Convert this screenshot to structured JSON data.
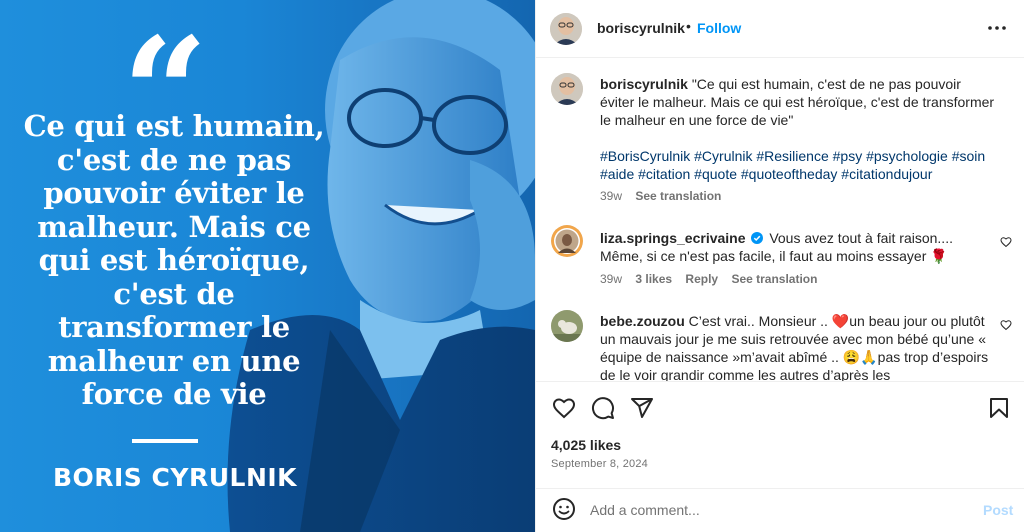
{
  "post_image": {
    "quote_mark": "“",
    "quote_lines": [
      "Ce qui est humain,",
      "c'est de ne pas",
      "pouvoir éviter le",
      "malheur. Mais ce",
      "qui est héroïque,",
      "c'est de",
      "transformer le",
      "malheur en une",
      "force de vie"
    ],
    "author": "BORIS CYRULNIK"
  },
  "header": {
    "username": "boriscyrulnik",
    "separator": "•",
    "follow_label": "Follow",
    "more_icon": "more-horizontal-icon"
  },
  "caption": {
    "username": "boriscyrulnik",
    "text": "\"Ce qui est humain, c'est de ne pas pouvoir éviter le malheur. Mais ce qui est héroïque, c'est de transformer le malheur en une force de vie\"",
    "hashtags": "#BorisCyrulnik #Cyrulnik #Resilience #psy #psychologie #soin #aide #citation #quote #quoteoftheday #citationdujour",
    "age": "39w",
    "see_translation": "See translation"
  },
  "comments": [
    {
      "username": "liza.springs_ecrivaine",
      "verified": true,
      "text": "Vous avez tout à fait raison.... Même, si ce n'est pas facile, il faut au moins essayer 🌹",
      "age": "39w",
      "likes": "3 likes",
      "reply": "Reply",
      "see_translation": "See translation"
    },
    {
      "username": "bebe.zouzou",
      "text": "C’est vrai.. Monsieur .. ❤️un beau jour ou plutôt un mauvais jour je me suis retrouvée avec mon bébé qu’une « équipe de naissance »m’avait abîmé .. 😩🙏pas trop d’espoirs de le voir grandir comme les autres d’après les"
    }
  ],
  "actions": {
    "icons": [
      "heart-icon",
      "comment-icon",
      "share-icon",
      "save-icon"
    ]
  },
  "likes": "4,025 likes",
  "date": "September 8, 2024",
  "composer": {
    "placeholder": "Add a comment...",
    "post_label": "Post"
  },
  "colors": {
    "accent": "#0095f6",
    "hashtag": "#00376b",
    "muted": "#737373",
    "image_blue": "#1a86d6"
  }
}
